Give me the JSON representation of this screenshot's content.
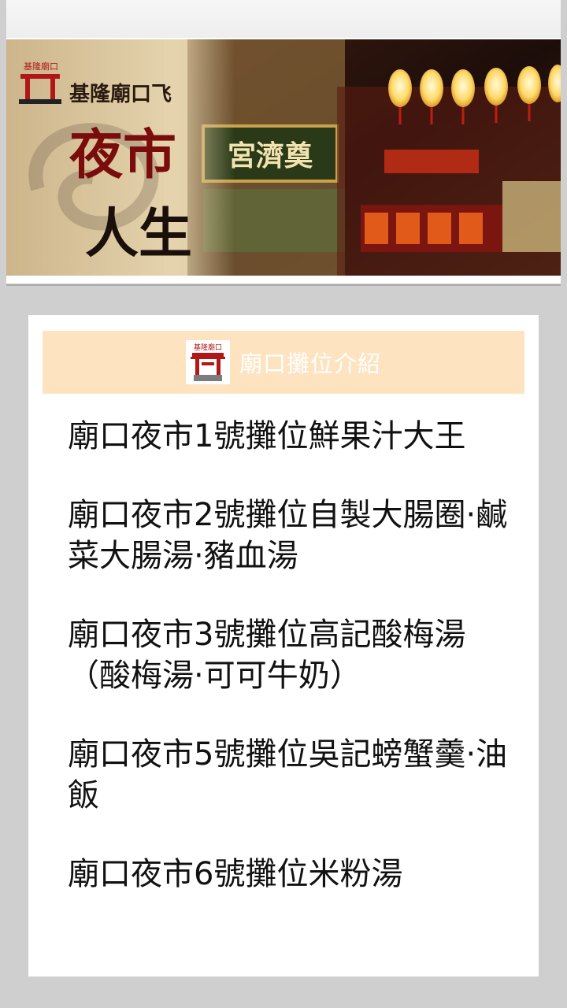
{
  "banner": {
    "logo_text": "基隆廟口",
    "brand_text": "基隆廟口飞",
    "slogan_line1": "夜市",
    "slogan_line2": "人生",
    "temple_sign": "宮濟奠"
  },
  "card": {
    "header_title": "廟口攤位介紹",
    "header_logo_text": "基隆廟口",
    "items": [
      {
        "label": "廟口夜市1號攤位鮮果汁大王"
      },
      {
        "label": "廟口夜市2號攤位自製大腸圈·鹹菜大腸湯·豬血湯"
      },
      {
        "label": "廟口夜市3號攤位高記酸梅湯（酸梅湯·可可牛奶）"
      },
      {
        "label": "廟口夜市5號攤位吳記螃蟹羹·油飯"
      },
      {
        "label": "廟口夜市6號攤位米粉湯"
      }
    ]
  },
  "colors": {
    "page_bg": "#cfcfcf",
    "header_bg": "#fde3c0",
    "header_text": "#ffffff",
    "item_text": "#111111",
    "logo_red": "#b01818"
  }
}
